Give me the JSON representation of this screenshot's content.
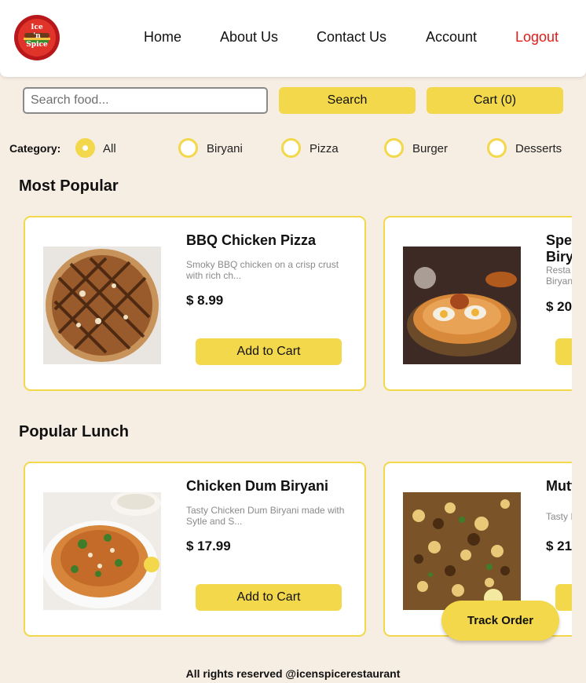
{
  "header": {
    "logo_text": "Ice 'n Spice",
    "nav": [
      {
        "label": "Home"
      },
      {
        "label": "About Us"
      },
      {
        "label": "Contact Us"
      },
      {
        "label": "Account"
      },
      {
        "label": "Logout",
        "color": "#e41b17"
      }
    ]
  },
  "search": {
    "placeholder": "Search food...",
    "value": "",
    "button_label": "Search"
  },
  "cart": {
    "label": "Cart (0)"
  },
  "category": {
    "label": "Category:",
    "options": [
      "All",
      "Biryani",
      "Pizza",
      "Burger",
      "Desserts"
    ],
    "selected": "All"
  },
  "sections": [
    {
      "title": "Most Popular",
      "items": [
        {
          "name": "BBQ Chicken Pizza",
          "description": "Smoky BBQ chicken on a crisp crust with rich ch...",
          "price": "$ 8.99",
          "button": "Add to Cart",
          "image": "pizza"
        },
        {
          "name": "Spe",
          "name_line2": "Biry",
          "description": "Resta",
          "description_line2": "Biryan",
          "price": "$ 20",
          "button": "",
          "image": "biryani-egg"
        }
      ]
    },
    {
      "title": "Popular Lunch",
      "items": [
        {
          "name": "Chicken Dum Biryani",
          "description": "Tasty Chicken Dum Biryani made with Sytle and S...",
          "price": "$ 17.99",
          "button": "Add to Cart",
          "image": "biryani-plate"
        },
        {
          "name": "Mutt",
          "description": "Tasty I",
          "price": "$ 21",
          "button": "",
          "image": "mutton-biryani"
        }
      ]
    }
  ],
  "track_order": {
    "label": "Track Order"
  },
  "footer": {
    "text": "All rights reserved @icenspicerestaurant"
  },
  "colors": {
    "accent": "#f2d84a",
    "background": "#f6ede3",
    "logout": "#e41b17"
  }
}
